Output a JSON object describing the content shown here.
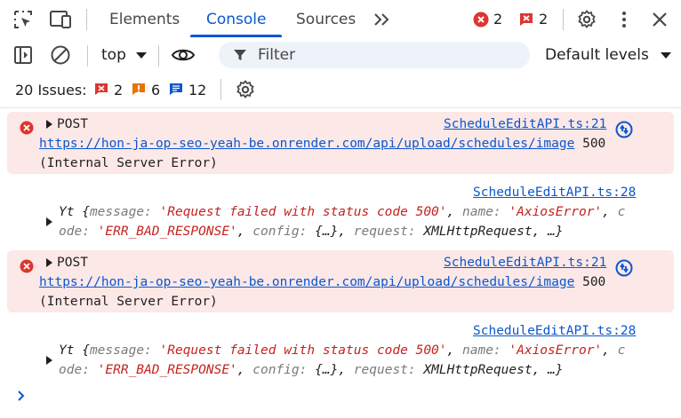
{
  "tabs": [
    {
      "label": "Elements",
      "active": false
    },
    {
      "label": "Console",
      "active": true
    },
    {
      "label": "Sources",
      "active": false
    }
  ],
  "header": {
    "error_count": "2",
    "issue_count": "2"
  },
  "toolbar": {
    "context": "top",
    "filter_placeholder": "Filter",
    "levels": "Default levels"
  },
  "issues": {
    "label": "20 Issues:",
    "errors": "2",
    "warnings": "6",
    "info": "12"
  },
  "messages": [
    {
      "level": "error",
      "method": "POST",
      "source": "ScheduleEditAPI.ts:21",
      "url": "https://hon-ja-op-seo-yeah-be.onrender.com/api/upload/schedules/image",
      "status": "500",
      "status_text": "(Internal Server Error)"
    },
    {
      "level": "info",
      "source": "ScheduleEditAPI.ts:28",
      "obj_name": "Yt",
      "message_key": "message",
      "message_val": "'Request failed with status code 500'",
      "name_key": "name",
      "name_val": "'AxiosError'",
      "code_key": "code",
      "code_val": "'ERR_BAD_RESPONSE'",
      "config_key": "config",
      "config_val": "{…}",
      "request_key": "request",
      "request_val": "XMLHttpRequest",
      "ellipsis": "…"
    },
    {
      "level": "error",
      "method": "POST",
      "source": "ScheduleEditAPI.ts:21",
      "url": "https://hon-ja-op-seo-yeah-be.onrender.com/api/upload/schedules/image",
      "status": "500",
      "status_text": "(Internal Server Error)"
    },
    {
      "level": "info",
      "source": "ScheduleEditAPI.ts:28",
      "obj_name": "Yt",
      "message_key": "message",
      "message_val": "'Request failed with status code 500'",
      "name_key": "name",
      "name_val": "'AxiosError'",
      "code_key": "code",
      "code_val": "'ERR_BAD_RESPONSE'",
      "config_key": "config",
      "config_val": "{…}",
      "request_key": "request",
      "request_val": "XMLHttpRequest",
      "ellipsis": "…"
    }
  ],
  "colors": {
    "accent": "#0b57d0",
    "error": "#dc362e",
    "warning": "#e37400",
    "info_blue": "#0b57d0",
    "error_bg": "#fce8e6"
  }
}
